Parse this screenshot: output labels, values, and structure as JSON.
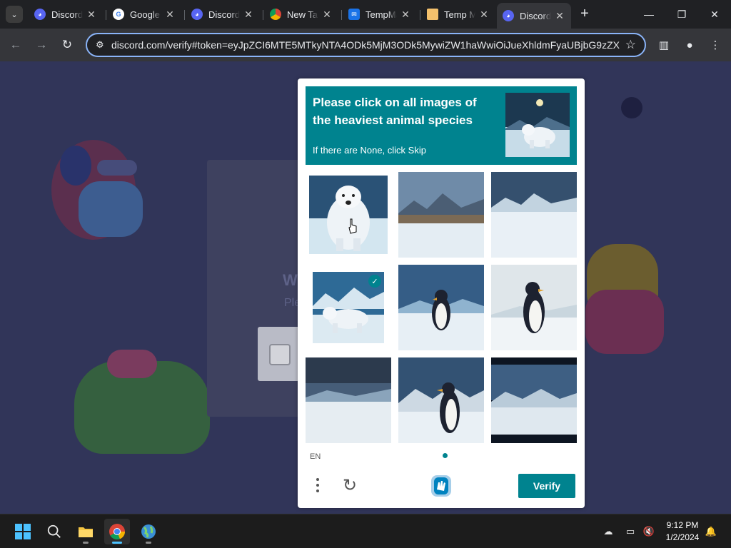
{
  "browser": {
    "tabs": [
      {
        "title": "Discord",
        "favicon": "discord-icon",
        "active": false
      },
      {
        "title": "Google",
        "favicon": "google-icon",
        "active": false
      },
      {
        "title": "Discord",
        "favicon": "discord-icon",
        "active": false
      },
      {
        "title": "New Tab",
        "favicon": "chrome-icon",
        "active": false
      },
      {
        "title": "TempMail",
        "favicon": "mail-icon",
        "active": false
      },
      {
        "title": "Temp Mail",
        "favicon": "envelope-icon",
        "active": false
      },
      {
        "title": "Discord",
        "favicon": "discord-icon",
        "active": true
      }
    ],
    "url_host": "discord.com",
    "url_path": "/verify#token=eyJpZCI6MTE5MTkyNTA4ODk5MjM3ODk5MywiZW1haWwiOiJueXhldmFyaUBjbG9zZX..."
  },
  "background_page": {
    "heading_partial": "W",
    "subtext_partial": "Ple"
  },
  "captcha": {
    "prompt": "Please click on all images of the heaviest animal species",
    "hint": "If there are None, click Skip",
    "example_image": "polar-bear",
    "tiles": [
      {
        "subject": "polar-bear",
        "selected": false
      },
      {
        "subject": "snowy-mountain-landscape",
        "selected": false
      },
      {
        "subject": "snowy-mountain-landscape",
        "selected": false
      },
      {
        "subject": "polar-bear",
        "selected": true
      },
      {
        "subject": "penguin",
        "selected": false
      },
      {
        "subject": "penguin",
        "selected": false
      },
      {
        "subject": "snowy-landscape",
        "selected": false
      },
      {
        "subject": "penguin",
        "selected": false
      },
      {
        "subject": "snowy-mountain-landscape",
        "selected": false
      }
    ],
    "language": "EN",
    "verify_label": "Verify",
    "accent_color": "#00838f"
  },
  "taskbar": {
    "apps": [
      "start-icon",
      "search-icon",
      "file-explorer-icon",
      "chrome-icon",
      "globe-app-icon"
    ],
    "time": "9:12 PM",
    "date": "1/2/2024"
  }
}
